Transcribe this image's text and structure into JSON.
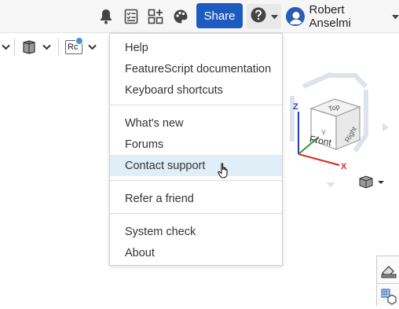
{
  "header": {
    "share_label": "Share",
    "user_name": "Robert Anselmi",
    "icons": [
      "bell-icon",
      "tasks-icon",
      "apps-icon",
      "palette-icon",
      "help-icon"
    ]
  },
  "menu": {
    "group1": [
      "Help",
      "FeatureScript documentation",
      "Keyboard shortcuts"
    ],
    "group2": [
      "What's new",
      "Forums",
      "Contact support"
    ],
    "group3": [
      "Refer a friend"
    ],
    "group4": [
      "System check",
      "About"
    ],
    "hovered": "Contact support"
  },
  "viewcube": {
    "faces": {
      "top": "Top",
      "front": "Front",
      "right": "Right"
    },
    "axes": {
      "x": "X",
      "y": "Y",
      "z": "Z"
    }
  },
  "toolbar": {
    "rendering_label": "Rc"
  },
  "colors": {
    "share_bg": "#1e5bbf",
    "menu_hover": "#dfeef7",
    "axis_x": "#e02020",
    "axis_y": "#2e9a2e",
    "axis_z": "#2a3ab0"
  }
}
